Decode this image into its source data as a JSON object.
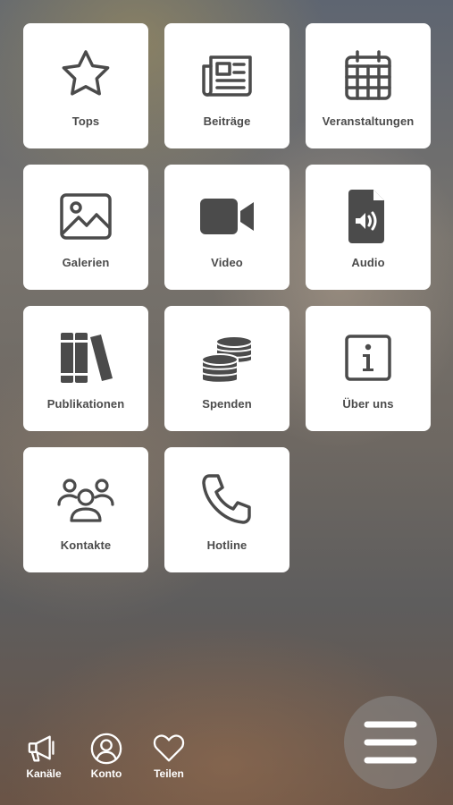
{
  "tiles": [
    {
      "label": "Tops",
      "icon": "star-icon"
    },
    {
      "label": "Beiträge",
      "icon": "newspaper-icon"
    },
    {
      "label": "Veranstaltungen",
      "icon": "calendar-icon"
    },
    {
      "label": "Galerien",
      "icon": "image-icon"
    },
    {
      "label": "Video",
      "icon": "video-camera-icon"
    },
    {
      "label": "Audio",
      "icon": "audio-file-icon"
    },
    {
      "label": "Publikationen",
      "icon": "books-icon"
    },
    {
      "label": "Spenden",
      "icon": "coins-icon"
    },
    {
      "label": "Über uns",
      "icon": "info-icon"
    },
    {
      "label": "Kontakte",
      "icon": "users-icon"
    },
    {
      "label": "Hotline",
      "icon": "phone-icon"
    }
  ],
  "bottom_nav": [
    {
      "label": "Kanäle",
      "icon": "megaphone-icon"
    },
    {
      "label": "Konto",
      "icon": "user-circle-icon"
    },
    {
      "label": "Teilen",
      "icon": "heart-icon"
    }
  ],
  "menu_button": {
    "icon": "hamburger-menu-icon"
  },
  "colors": {
    "tile_background": "#ffffff",
    "icon_and_label": "#4b4b4b",
    "nav_text": "#ffffff"
  }
}
